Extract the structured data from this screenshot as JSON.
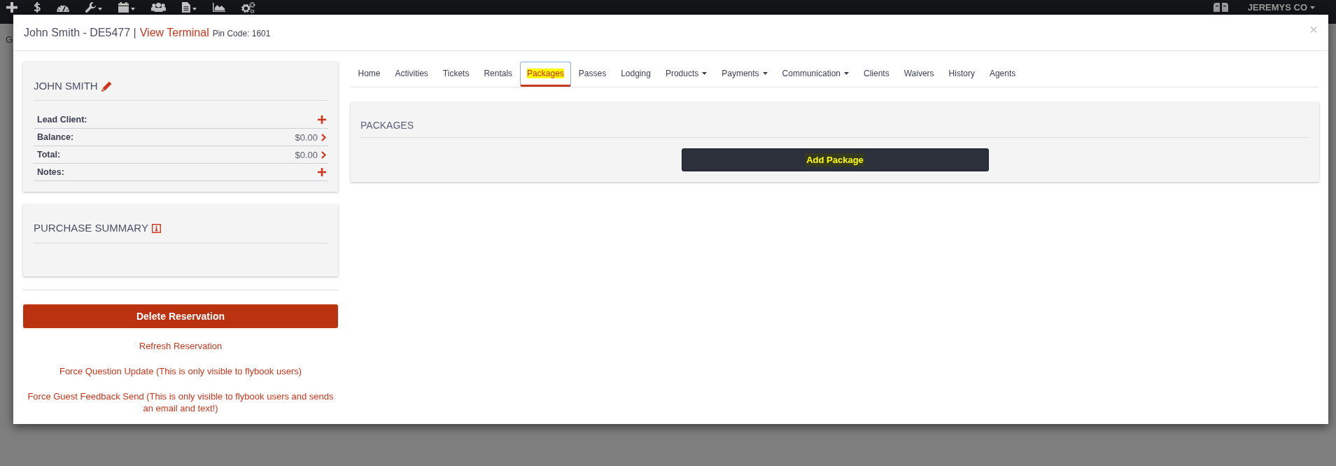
{
  "navbar": {
    "account": {
      "label": "JEREMYS CO",
      "has_menu": true
    }
  },
  "background_page": {
    "text": "G"
  },
  "modal": {
    "title": {
      "name": "John Smith - DE5477 |",
      "link": "View Terminal",
      "pin_code": "Pin Code: 1601"
    },
    "close": "×"
  },
  "client_card": {
    "title": "JOHN SMITH",
    "rows": [
      {
        "label": "Lead Client:",
        "kind": "add"
      },
      {
        "label": "Balance:",
        "kind": "amount",
        "value": "$0.00"
      },
      {
        "label": "Total:",
        "kind": "amount",
        "value": "$0.00"
      },
      {
        "label": "Notes:",
        "kind": "add"
      }
    ]
  },
  "purchase_summary": {
    "title": "PURCHASE SUMMARY"
  },
  "actions": {
    "delete_button": "Delete Reservation",
    "links": [
      "Refresh Reservation",
      "Force Question Update (This is only visible to flybook users)",
      "Force Guest Feedback Send (This is only visible to flybook users and sends an email and text!)"
    ]
  },
  "tabs": [
    {
      "label": "Home",
      "selected": false,
      "has_menu": false,
      "highlighted": false
    },
    {
      "label": "Activities",
      "selected": false,
      "has_menu": false,
      "highlighted": false
    },
    {
      "label": "Tickets",
      "selected": false,
      "has_menu": false,
      "highlighted": false
    },
    {
      "label": "Rentals",
      "selected": false,
      "has_menu": false,
      "highlighted": false
    },
    {
      "label": "Packages",
      "selected": true,
      "has_menu": false,
      "highlighted": true
    },
    {
      "label": "Passes",
      "selected": false,
      "has_menu": false,
      "highlighted": false
    },
    {
      "label": "Lodging",
      "selected": false,
      "has_menu": false,
      "highlighted": false
    },
    {
      "label": "Products",
      "selected": false,
      "has_menu": true,
      "highlighted": false
    },
    {
      "label": "Payments",
      "selected": false,
      "has_menu": true,
      "highlighted": false
    },
    {
      "label": "Communication",
      "selected": false,
      "has_menu": true,
      "highlighted": false
    },
    {
      "label": "Clients",
      "selected": false,
      "has_menu": false,
      "highlighted": false
    },
    {
      "label": "Waivers",
      "selected": false,
      "has_menu": false,
      "highlighted": false
    },
    {
      "label": "History",
      "selected": false,
      "has_menu": false,
      "highlighted": false
    },
    {
      "label": "Agents",
      "selected": false,
      "has_menu": false,
      "highlighted": false
    }
  ],
  "packages_panel": {
    "title": "PACKAGES",
    "add_button": {
      "label": "Add Package",
      "highlighted": true
    }
  }
}
